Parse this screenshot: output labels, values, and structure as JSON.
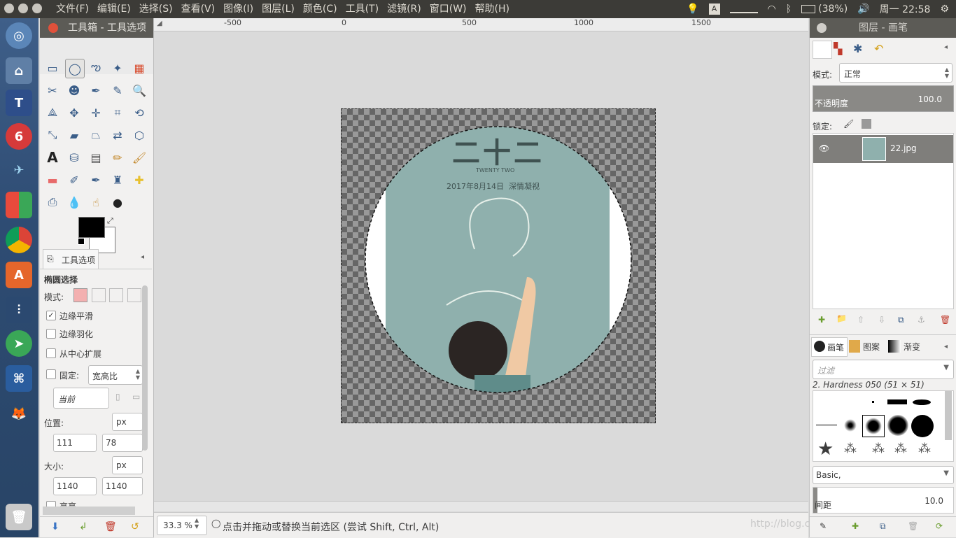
{
  "menubar": {
    "items": [
      "文件(F)",
      "编辑(E)",
      "选择(S)",
      "查看(V)",
      "图像(I)",
      "图层(L)",
      "颜色(C)",
      "工具(T)",
      "滤镜(R)",
      "窗口(W)",
      "帮助(H)"
    ],
    "battery": "(38%)",
    "clock": "周一 22:58"
  },
  "toolbox": {
    "title": "工具箱 - 工具选项",
    "options_tab": "工具选项",
    "tool_name": "椭圆选择",
    "mode_label": "模式:",
    "antialias": "边缘平滑",
    "feather": "边缘羽化",
    "expand_center": "从中心扩展",
    "fixed_label": "固定:",
    "fixed_value": "宽高比",
    "current_value": "当前",
    "position_label": "位置:",
    "position_unit": "px",
    "pos_x": "111",
    "pos_y": "78",
    "size_label": "大小:",
    "size_unit": "px",
    "size_w": "1140",
    "size_h": "1140",
    "highlight": "高亮"
  },
  "ruler": {
    "labels": [
      "-500",
      "0",
      "500",
      "1000",
      "1500"
    ]
  },
  "image_text": {
    "title": "二十二",
    "subtitle": "TWENTY TWO",
    "date": "2017年8月14日  深情凝视"
  },
  "statusbar": {
    "zoom": "33.3 %",
    "hint": "点击并拖动或替换当前选区 (尝试 Shift, Ctrl, Alt)",
    "watermark": "http://blog.csdn.net/wayne07"
  },
  "layers": {
    "title": "图层 - 画笔",
    "mode_label": "模式:",
    "mode_value": "正常",
    "opacity_label": "不透明度",
    "opacity_value": "100.0",
    "lock_label": "锁定:",
    "layer_name": "22.jpg"
  },
  "brushes": {
    "tabs": [
      "画笔",
      "图案",
      "渐变"
    ],
    "filter_placeholder": "过滤",
    "current_brush": "2. Hardness 050 (51 × 51)",
    "tag_value": "Basic,",
    "spacing_label": "间距",
    "spacing_value": "10.0"
  },
  "colors": {
    "accent": "#3a5d88",
    "titlebar": "#5c5b56",
    "topbar": "#3c3b37",
    "poster_bg": "#8fb0ad"
  }
}
